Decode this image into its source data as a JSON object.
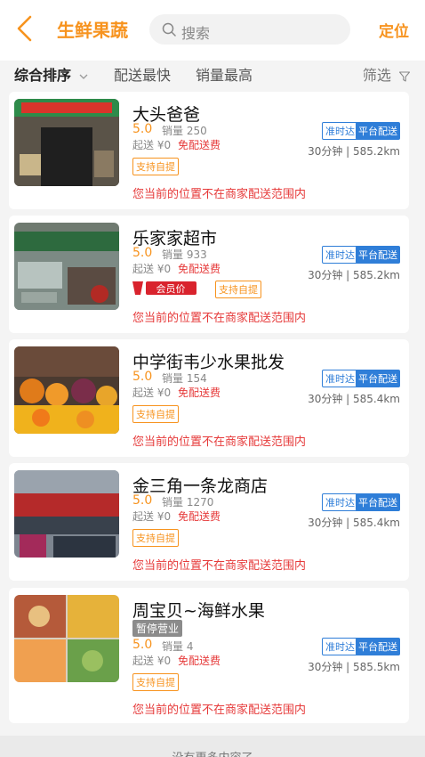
{
  "header": {
    "title": "生鲜果蔬",
    "search_placeholder": "搜索",
    "locate_label": "定位"
  },
  "filters": {
    "sort_label": "综合排序",
    "fastest_label": "配送最快",
    "sales_label": "销量最高",
    "filter_label": "筛选"
  },
  "colors": {
    "accent": "#f7931e",
    "warning": "#e63a3a",
    "platform_badge": "#2f7ed8"
  },
  "stores": [
    {
      "name": "大头爸爸",
      "rating": "5.0",
      "sales": "销量 250",
      "min_order": "起送 ¥0",
      "free_delivery": "免配送费",
      "pickup": "支持自提",
      "ontime": "准时达",
      "platform": "平台配送",
      "delivery_info": "30分钟 | 585.2km",
      "warning": "您当前的位置不在商家配送范围内"
    },
    {
      "name": "乐家家超市",
      "rating": "5.0",
      "sales": "销量 933",
      "min_order": "起送 ¥0",
      "free_delivery": "免配送费",
      "member_badge": "会员价",
      "pickup": "支持自提",
      "ontime": "准时达",
      "platform": "平台配送",
      "delivery_info": "30分钟 | 585.2km",
      "warning": "您当前的位置不在商家配送范围内"
    },
    {
      "name": "中学街韦少水果批发",
      "rating": "5.0",
      "sales": "销量 154",
      "min_order": "起送 ¥0",
      "free_delivery": "免配送费",
      "pickup": "支持自提",
      "ontime": "准时达",
      "platform": "平台配送",
      "delivery_info": "30分钟 | 585.4km",
      "warning": "您当前的位置不在商家配送范围内"
    },
    {
      "name": "金三角一条龙商店",
      "rating": "5.0",
      "sales": "销量 1270",
      "min_order": "起送 ¥0",
      "free_delivery": "免配送费",
      "pickup": "支持自提",
      "ontime": "准时达",
      "platform": "平台配送",
      "delivery_info": "30分钟 | 585.4km",
      "warning": "您当前的位置不在商家配送范围内"
    },
    {
      "name": "周宝贝~海鲜水果",
      "status": "暂停营业",
      "rating": "5.0",
      "sales": "销量 4",
      "min_order": "起送 ¥0",
      "free_delivery": "免配送费",
      "pickup": "支持自提",
      "ontime": "准时达",
      "platform": "平台配送",
      "delivery_info": "30分钟 | 585.5km",
      "warning": "您当前的位置不在商家配送范围内"
    }
  ],
  "footer": {
    "text": "没有更多内容了"
  }
}
